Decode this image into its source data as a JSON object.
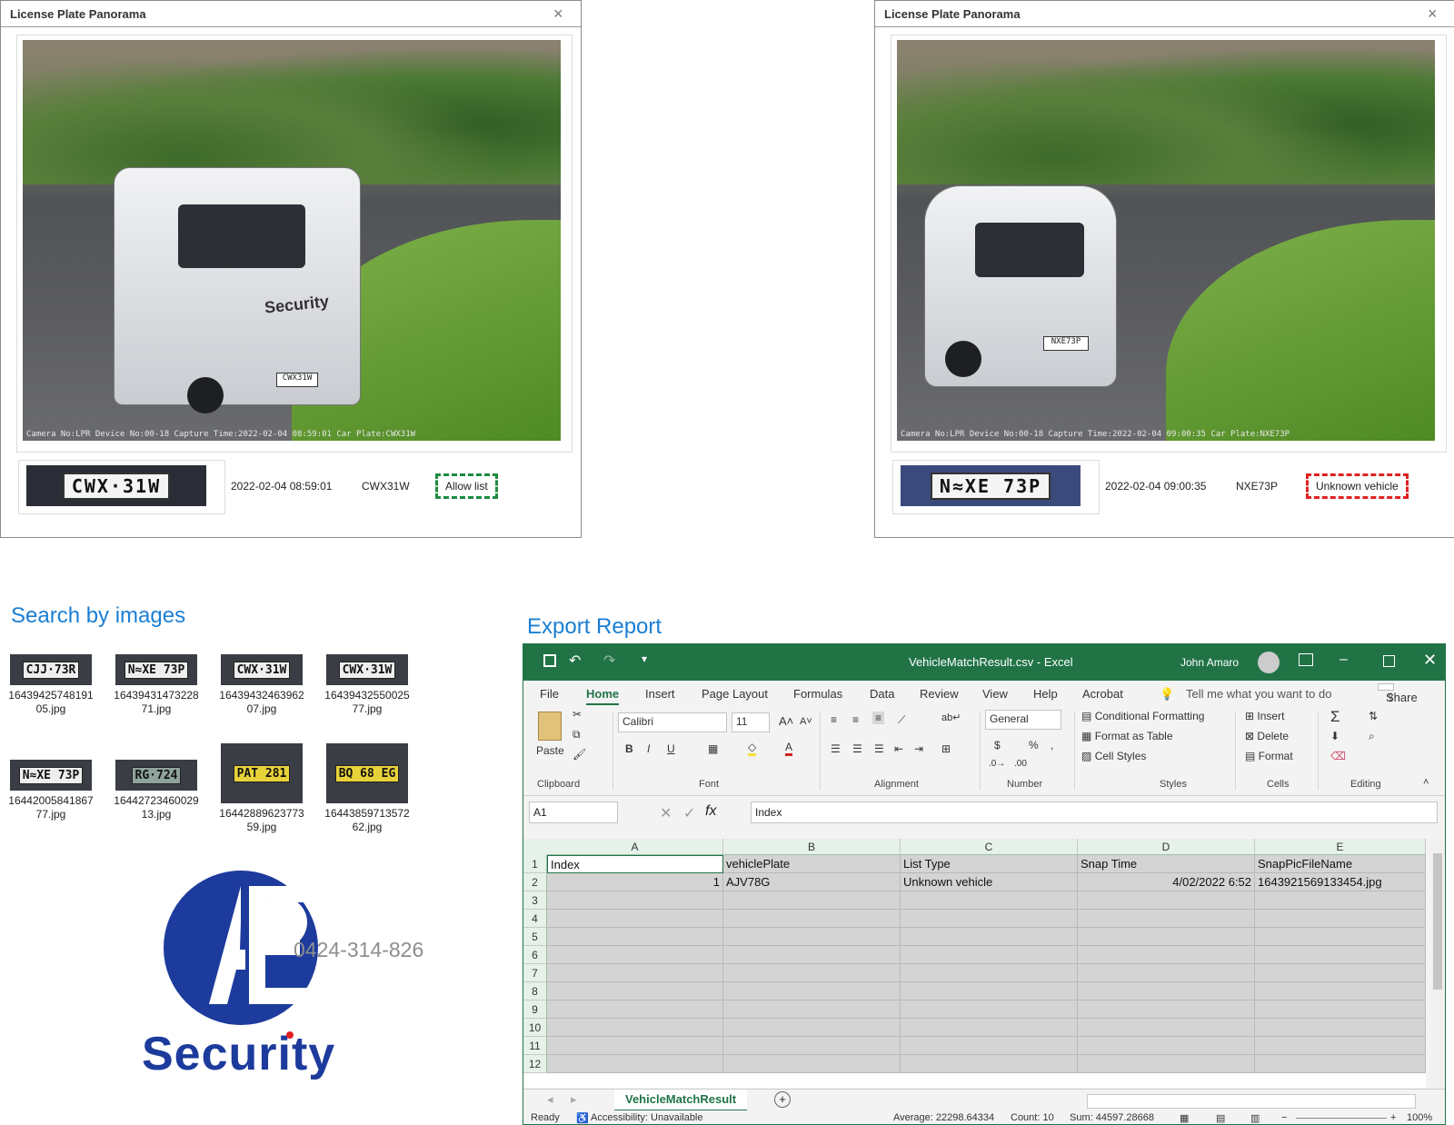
{
  "panorama_left": {
    "title": "License Plate Panorama",
    "close_glyph": "×",
    "scene_overlay": "Camera No:LPR   Device No:00-18  Capture Time:2022-02-04 08:59:01 Car Plate:CWX31W",
    "van_brand": "Security",
    "plate_crop_text": "CWX·31W",
    "datetime": "2022-02-04 08:59:01",
    "plate": "CWX31W",
    "list_status": "Allow list",
    "status_color": "#1e8a3e"
  },
  "panorama_right": {
    "title": "License Plate Panorama",
    "close_glyph": "×",
    "scene_overlay": "Camera No:LPR   Device No:00-18  Capture Time:2022-02-04 09:00:35 Car Plate:NXE73P",
    "plate_crop_text": "N≈XE 73P",
    "datetime": "2022-02-04 09:00:35",
    "plate": "NXE73P",
    "list_status": "Unknown vehicle",
    "status_color": "#e02020"
  },
  "search": {
    "title": "Search by images",
    "thumbnails": [
      {
        "plate": "CJJ·73R",
        "file": "1643942574819105.jpg"
      },
      {
        "plate": "N≈XE 73P",
        "file": "1643943147322871.jpg"
      },
      {
        "plate": "CWX·31W",
        "file": "1643943246396207.jpg"
      },
      {
        "plate": "CWX·31W",
        "file": "1643943255002577.jpg"
      },
      {
        "plate": "N≈XE 73P",
        "file": "1644200584186777.jpg"
      },
      {
        "plate": "RG·724",
        "file": "1644272346002913.jpg"
      },
      {
        "plate": "PAT 281",
        "file": "1644288962377359.jpg"
      },
      {
        "plate": "BQ 68 EG",
        "file": "1644385971357262.jpg"
      }
    ]
  },
  "logo": {
    "letters": "AE",
    "word": "Security",
    "phone": "0424-314-826",
    "brand_color": "#1d3b9c"
  },
  "export": {
    "title": "Export Report"
  },
  "excel": {
    "filename": "VehicleMatchResult.csv  -  Excel",
    "user": "John Amaro",
    "menu": [
      "File",
      "Home",
      "Insert",
      "Page Layout",
      "Formulas",
      "Data",
      "Review",
      "View",
      "Help",
      "Acrobat"
    ],
    "tell_me": "Tell me what you want to do",
    "share": "Share",
    "ribbon": {
      "paste": "Paste",
      "font_name": "Calibri",
      "font_size": "11",
      "number_format": "General",
      "conditional_formatting": "Conditional Formatting",
      "format_as_table": "Format as Table",
      "cell_styles": "Cell Styles",
      "insert": "Insert",
      "delete": "Delete",
      "format": "Format",
      "groups": {
        "clipboard": "Clipboard",
        "font": "Font",
        "alignment": "Alignment",
        "number": "Number",
        "styles": "Styles",
        "cells": "Cells",
        "editing": "Editing"
      }
    },
    "name_box": "A1",
    "formula": "Index",
    "columns": [
      "A",
      "B",
      "C",
      "D",
      "E"
    ],
    "rows": [
      "1",
      "2",
      "3",
      "4",
      "5",
      "6",
      "7",
      "8",
      "9",
      "10",
      "11",
      "12"
    ],
    "header_row": [
      "Index",
      "vehiclePlate",
      "List Type",
      "Snap Time",
      "SnapPicFileName"
    ],
    "data_row": [
      "1",
      "AJV78G",
      "Unknown vehicle",
      "4/02/2022 6:52",
      "1643921569133454.jpg"
    ],
    "sheet_tab": "VehicleMatchResult",
    "status": {
      "ready": "Ready",
      "accessibility": "Accessibility: Unavailable",
      "average": "Average: 22298.64334",
      "count": "Count: 10",
      "sum": "Sum: 44597.28668",
      "zoom": "100%"
    },
    "accent_color": "#217346"
  }
}
